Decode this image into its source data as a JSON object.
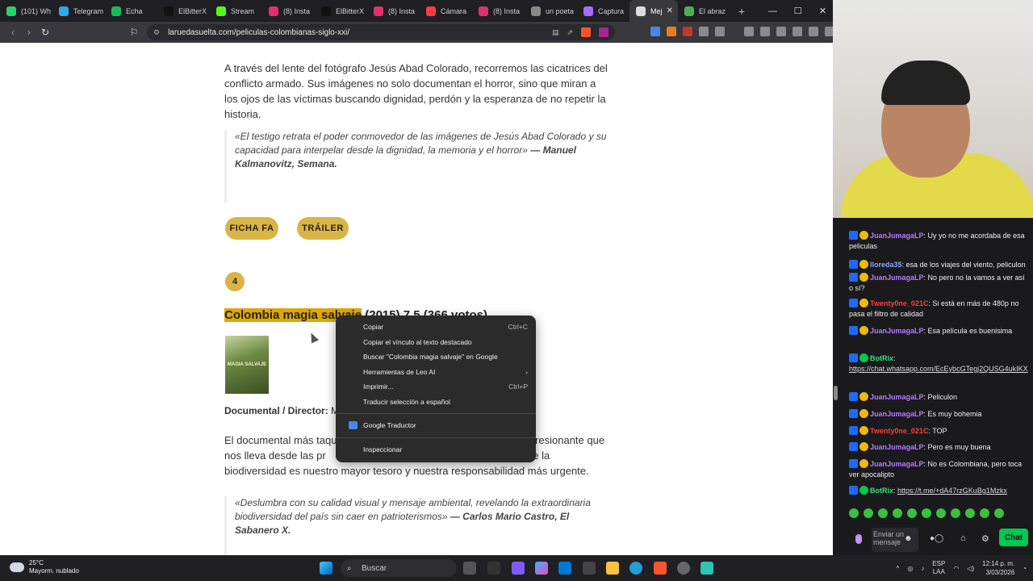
{
  "browser": {
    "tabs": [
      {
        "label": "(101) Wh",
        "color": "#25d366"
      },
      {
        "label": "Telegram",
        "color": "#2aabee"
      },
      {
        "label": "Echa",
        "color": "#1db954"
      },
      {
        "label": "ElBitterX",
        "color": "#111111"
      },
      {
        "label": "Stream",
        "color": "#53fc18"
      },
      {
        "label": "(8) Insta",
        "color": "#e1306c"
      },
      {
        "label": "ElBitterX",
        "color": "#111111"
      },
      {
        "label": "(8) Insta",
        "color": "#e1306c"
      },
      {
        "label": "Cámara",
        "color": "#ff3d3d"
      },
      {
        "label": "(8) Insta",
        "color": "#e1306c"
      },
      {
        "label": "un poeta",
        "color": "#888888"
      },
      {
        "label": "Captura",
        "color": "#a96cff"
      },
      {
        "label": "Mej",
        "color": "#dddddd",
        "active": true
      },
      {
        "label": "El abraz",
        "color": "#4caf50"
      }
    ],
    "new_tab": "+",
    "url": "laruedasuelta.com/peliculas-colombianas-siglo-xxi/"
  },
  "article": {
    "paragraph1": "A través del lente del fotógrafo Jesús Abad Colorado, recorremos las cicatrices del conflicto armado. Sus imágenes no solo documentan el horror, sino que miran a los ojos de las víctimas buscando dignidad, perdón y la esperanza de no repetir la historia.",
    "quote1_text": "«El testigo retrata el poder conmovedor de las imágenes de Jesús Abad Colorado y su capacidad para interpelar desde la dignidad, la memoria y el horror»",
    "quote1_author": "— Manuel Kalmanovitz, Semana.",
    "btn_ficha": "FICHA FA",
    "btn_trailer": "TRÁILER",
    "number": "4",
    "title_highlight": "Colombia magia salvaje",
    "title_rest": " (2015) 7.5 (366 votos)",
    "poster_text": "MAGIA SALVAJE",
    "meta_label": "Documental / Director:",
    "meta_value": " Mike",
    "paragraph2": "El documental más taquill                                                       co impresionante que nos lleva desde las pr                                                 rdándonos que la biodiversidad es nuestro mayor tesoro y nuestra responsabilidad más urgente.",
    "quote2_text": "«Deslumbra con su calidad visual y mensaje ambiental, revelando la extraordinaria biodiversidad del país sin caer en patrioterismos»",
    "quote2_author": "— Carlos Mario Castro, El Sabanero X."
  },
  "context_menu": {
    "items": [
      {
        "label": "Copiar",
        "shortcut": "Ctrl+C"
      },
      {
        "label": "Copiar el vínculo al texto destacado",
        "shortcut": ""
      },
      {
        "label": "Buscar \"Colombia magia salvaje\" en Google",
        "shortcut": ""
      },
      {
        "label": "Herramientas de Leo AI",
        "shortcut": "›"
      },
      {
        "label": "Imprimir...",
        "shortcut": "Ctrl+P"
      },
      {
        "label": "Traducir selección a español",
        "shortcut": ""
      }
    ],
    "translator": "Google Traductor",
    "inspect": "Inspeccionar"
  },
  "chat": {
    "messages": [
      {
        "user": "JuanJumagaLP",
        "color": "#b57bff",
        "text": ": Uy yo no me acordaba de esa peliculas"
      },
      {
        "user": "lloreda35",
        "color": "#8aa4ff",
        "text": ": esa de los viajes del viento, peliculon"
      },
      {
        "user": "JuanJumagaLP",
        "color": "#b57bff",
        "text": ": No pero no la vamos a ver así o sí?"
      },
      {
        "user": "Twenty0ne_021C",
        "color": "#ff3b3b",
        "text": ": Si está en más de 480p no pasa el filtro de calidad"
      },
      {
        "user": "JuanJumagaLP",
        "color": "#b57bff",
        "text": ": Esa película es buenisima"
      },
      {
        "user": "BotRix",
        "color": "#39e27a",
        "text": ":",
        "link": "https://chat.whatsapp.com/EcEybcGTegj2QUSG4ukIKX"
      },
      {
        "user": "JuanJumagaLP",
        "color": "#b57bff",
        "text": ": Peliculon"
      },
      {
        "user": "JuanJumagaLP",
        "color": "#b57bff",
        "text": ": Es muy bohemia"
      },
      {
        "user": "Twenty0ne_021C",
        "color": "#ff3b3b",
        "text": ": TOP"
      },
      {
        "user": "JuanJumagaLP",
        "color": "#b57bff",
        "text": ": Pero es muy buena"
      },
      {
        "user": "JuanJumagaLP",
        "color": "#b57bff",
        "text": ": No es Colombiana, pero toca ver apocalipto"
      },
      {
        "user": "BotRix",
        "color": "#39e27a",
        "text": ": ",
        "link": "https://t.me/+dA47rzGKuBg1Mzkx"
      }
    ],
    "input_placeholder": "Enviar un mensaje",
    "send_label": "Chat"
  },
  "taskbar": {
    "temp": "25°C",
    "weather": "Mayorm. nublado",
    "search_placeholder": "Buscar",
    "lang": "ESP",
    "lang2": "LAA",
    "time": "12:14 p. m.",
    "date": "3/03/2026"
  }
}
